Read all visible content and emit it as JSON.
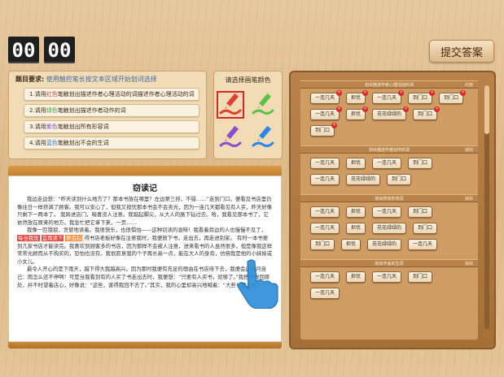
{
  "timer": {
    "minutes": "00",
    "seconds": "00"
  },
  "submit_label": "提交答案",
  "question": {
    "heading": "题目要求:",
    "note": "使用触控笔长按文本区域开始划词选择",
    "items": [
      {
        "num": "1.请用",
        "color": "红色",
        "rest": "笔触划出描述作者心理活动的词描述作者心理活动的词"
      },
      {
        "num": "2.请用",
        "color": "绿色",
        "rest": "笔触划出描述作者动作的词"
      },
      {
        "num": "3.请用",
        "color": "紫色",
        "rest": "笔触划出所有形容词"
      },
      {
        "num": "4.请用",
        "color": "蓝色",
        "rest": "笔触划出不会的生词"
      }
    ]
  },
  "pen_panel": {
    "title": "请选择画笔颜色",
    "pens": [
      {
        "name": "red",
        "color": "#e04036",
        "selected": true
      },
      {
        "name": "green",
        "color": "#5cc24a",
        "selected": false
      },
      {
        "name": "purple",
        "color": "#8c4fcc",
        "selected": false
      },
      {
        "name": "blue",
        "color": "#2f86e8",
        "selected": false
      }
    ]
  },
  "reading": {
    "title": "窃读记",
    "p1": "我边走边想：“昨天读到什么地方了？那本书放在哪里？左边第三排，不错……”走到门口，便看见书店里仍像往日一样挤满了顾客。我可以安心了，但我又担忧那本书会不会卖光，因为一连几天都看见有人买，昨天好像只剩下一两本了。",
    "p2": "我跨进店门，暗喜没人注意。我踮起脚尖，从大人的胳下钻过去。哈，我看见那本书了，它依然放在原来的地方。我急忙把它拿下来，一页……",
    "p3": "我像一匹饿狼，贪婪地读着。我很快乐，也很惧怕——这种窃读的滋味！我看着旁边的人也慢慢不见了，",
    "hl1": "每当我觉",
    "hl2": "宜再读下",
    "hl3": "静会起",
    "p4": "得书店老板好像在注意我时，我便放下书，走出去，再走进别家。",
    "p5": "有时一本书要到几家书店才能读完。我喜欢到顾客多的书店，因为那样不会被人注意，进来看书的人虽然很多，但是像我这样常常光顾而从不购买的，恐怕也没有。我很愿意我的个子再长高一点，能在大人的身旁，仿佛我是他的小妹妹或小女儿。",
    "p6": "最令人开心的是下雨天，越下得大我越高兴，因为那时我便有充足的理由在书店待下去，我便会这样问自己：雨怎么还不停啊！可是当我看到有的人买了书走出去时，我便想：“只要有人买书，就够了。”我把书放回原处，并不时望着店心，好像说：“这些，害得我回不去了。”其实，我的心里却高兴地喊着：“大些！再大些！”"
  },
  "answers": {
    "groups": [
      {
        "title": "划出描述作者心理活动的词",
        "action": "收藏",
        "chips": [
          "一连几天",
          "担忧",
          "一连几天",
          "到门口",
          "到门口",
          "一连几天",
          "担忧",
          "花花绿绿的",
          "到门口",
          "到门口"
        ],
        "removable": true
      },
      {
        "title": "划出描述作者动作的词",
        "action": "编辑",
        "chips": [
          "一连几天",
          "担忧",
          "一连几天",
          "到门口",
          "一连几天",
          "花花绿绿的",
          "到门口"
        ],
        "removable": false
      },
      {
        "title": "划出所有形容词",
        "action": "编辑",
        "chips": [
          "一连几天",
          "担忧",
          "一连几天",
          "到门口",
          "一连几天",
          "担忧",
          "花花绿绿的",
          "到门口",
          "到门口",
          "担忧",
          "花花绿绿的",
          "一连几天"
        ],
        "removable": false
      },
      {
        "title": "划出不会的生词",
        "action": "编辑",
        "chips": [
          "一连几天",
          "担忧",
          "一连几天",
          "到门口",
          "一连几天"
        ],
        "removable": false
      }
    ]
  }
}
